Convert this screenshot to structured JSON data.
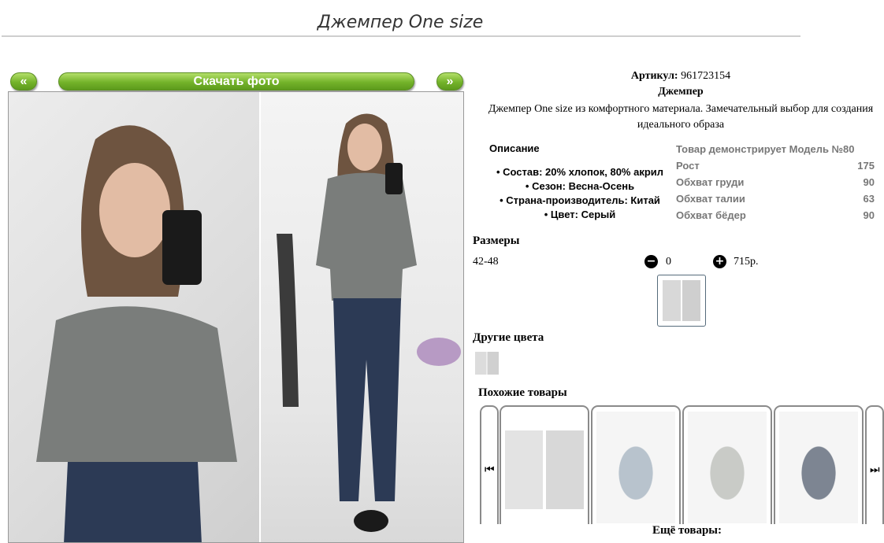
{
  "page": {
    "title": "Джемпер One size"
  },
  "gallery": {
    "prev_label": "«",
    "next_label": "»",
    "download_label": "Скачать фото"
  },
  "product": {
    "article_label": "Артикул:",
    "article_value": "961723154",
    "name": "Джемпер",
    "description": "Джемпер One size из комфортного материала. Замечательный выбор для создания идеального образа"
  },
  "details": {
    "heading": "Описание",
    "items": [
      "Состав: 20% хлопок, 80% акрил",
      "Сезон: Весна-Осень",
      "Страна-производитель: Китай",
      "Цвет: Серый"
    ]
  },
  "model": {
    "heading": "Товар демонстрирует Модель №80",
    "rows": [
      {
        "label": "Рост",
        "value": "175"
      },
      {
        "label": "Обхват груди",
        "value": "90"
      },
      {
        "label": "Обхват талии",
        "value": "63"
      },
      {
        "label": "Обхват бёдер",
        "value": "90"
      }
    ]
  },
  "sizes": {
    "heading": "Размеры",
    "size": "42-48",
    "minus_icon": "minus-circle-icon",
    "plus_icon": "plus-circle-icon",
    "quantity": "0",
    "price": "715р."
  },
  "colors": {
    "heading": "Другие цвета"
  },
  "similar": {
    "heading": "Похожие товары",
    "prev_icon": "skip-back-icon",
    "next_icon": "skip-forward-icon"
  },
  "more": {
    "heading": "Ещё товары:"
  }
}
